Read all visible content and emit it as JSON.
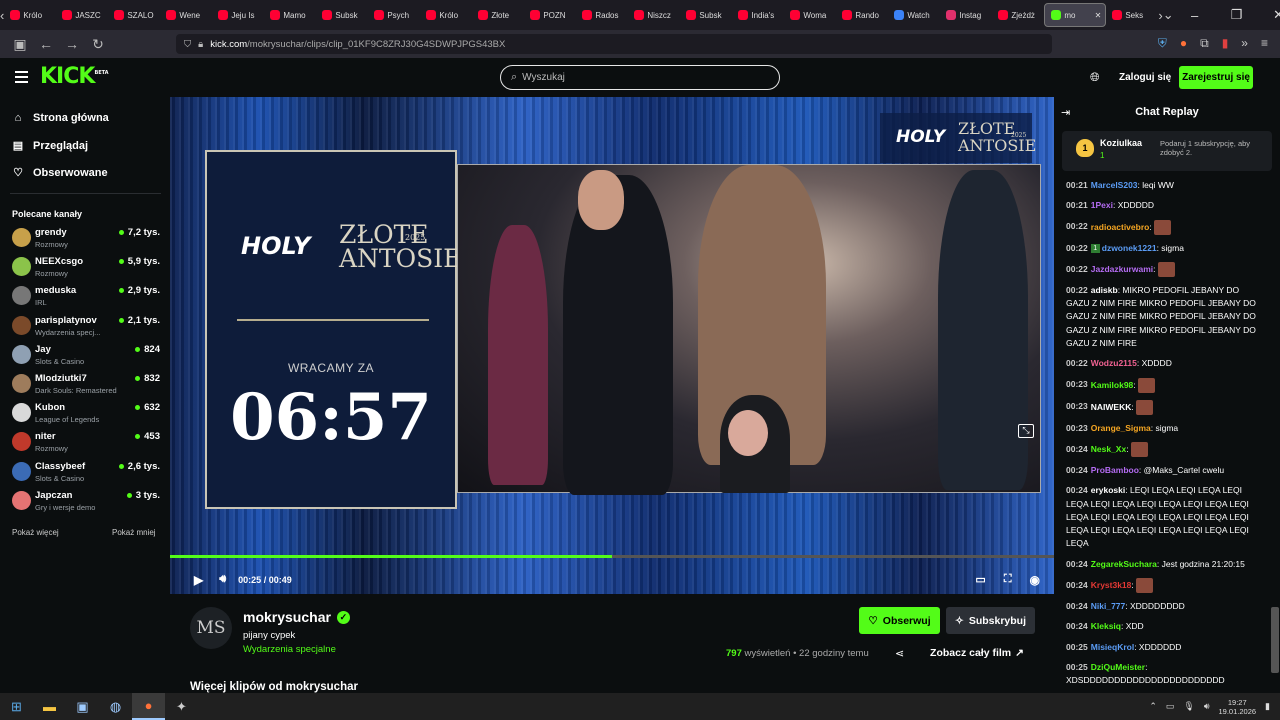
{
  "browser": {
    "tabs": [
      {
        "label": "Królo",
        "color": "#ff0033"
      },
      {
        "label": "JASZC",
        "color": "#ff0033"
      },
      {
        "label": "SZALO",
        "color": "#ff0033"
      },
      {
        "label": "Wene",
        "color": "#ff0033"
      },
      {
        "label": "Jeju Is",
        "color": "#ff0033"
      },
      {
        "label": "Mamo",
        "color": "#ff0033"
      },
      {
        "label": "Subsk",
        "color": "#ff0033"
      },
      {
        "label": "Psych",
        "color": "#ff0033"
      },
      {
        "label": "Królo",
        "color": "#ff0033"
      },
      {
        "label": "Złote",
        "color": "#ff0033"
      },
      {
        "label": "POZN",
        "color": "#ff0033"
      },
      {
        "label": "Rados",
        "color": "#ff0033"
      },
      {
        "label": "Niszcz",
        "color": "#ff0033"
      },
      {
        "label": "Subsk",
        "color": "#ff0033"
      },
      {
        "label": "India's",
        "color": "#ff0033"
      },
      {
        "label": "Woma",
        "color": "#ff0033"
      },
      {
        "label": "Rando",
        "color": "#ff0033"
      },
      {
        "label": "Watch",
        "color": "#3b82f6"
      },
      {
        "label": "Instag",
        "color": "#e1306c"
      },
      {
        "label": "Zjeżdż",
        "color": "#ff0033"
      }
    ],
    "active_tab": {
      "label": "mo",
      "color": "#53fc18"
    },
    "last_tab": {
      "label": "Seks",
      "color": "#ff0033"
    },
    "url_host": "kick.com",
    "url_path": "/mokrysuchar/clips/clip_01KF9C8ZRJ30G4SDWPJPGS43BX"
  },
  "header": {
    "logo": "KICK",
    "beta": "BETA",
    "search_placeholder": "Wyszukaj",
    "login": "Zaloguj się",
    "register": "Zarejestruj się"
  },
  "sidebar": {
    "nav": [
      {
        "label": "Strona główna",
        "icon": "home-icon"
      },
      {
        "label": "Przeglądaj",
        "icon": "browse-icon"
      },
      {
        "label": "Obserwowane",
        "icon": "heart-icon"
      }
    ],
    "recommended_title": "Polecane kanały",
    "channels": [
      {
        "name": "grendy",
        "category": "Rozmowy",
        "viewers": "7,2 tys.",
        "color": "#c7a04a"
      },
      {
        "name": "NEEXcsgo",
        "category": "Rozmowy",
        "viewers": "5,9 tys.",
        "color": "#8bc34a"
      },
      {
        "name": "meduska",
        "category": "IRL",
        "viewers": "2,9 tys.",
        "color": "#777777"
      },
      {
        "name": "parisplatynov",
        "category": "Wydarzenia specj...",
        "viewers": "2,1 tys.",
        "color": "#7b4a2a"
      },
      {
        "name": "Jay",
        "category": "Slots & Casino",
        "viewers": "824",
        "color": "#8fa0b3"
      },
      {
        "name": "Mlodziutki7",
        "category": "Dark Souls: Remastered",
        "viewers": "832",
        "color": "#9e7c5c"
      },
      {
        "name": "Kubon",
        "category": "League of Legends",
        "viewers": "632",
        "color": "#d9d9d9"
      },
      {
        "name": "niter",
        "category": "Rozmowy",
        "viewers": "453",
        "color": "#c0392b"
      },
      {
        "name": "Classybeef",
        "category": "Slots & Casino",
        "viewers": "2,6 tys.",
        "color": "#3b6bb5"
      },
      {
        "name": "Japczan",
        "category": "Gry i wersje demo",
        "viewers": "3 tys.",
        "color": "#e57373"
      }
    ],
    "show_more": "Pokaż więcej",
    "show_less": "Pokaż mniej"
  },
  "video": {
    "overlay_brand": "HOLY",
    "overlay_title_1": "ZŁOTE",
    "overlay_title_2": "ANTOSIE",
    "overlay_year": "2025",
    "countdown_label": "WRACAMY ZA",
    "countdown": "06:57",
    "time_current": "00:25",
    "time_total": "00:49",
    "progress": 0.5
  },
  "channel": {
    "avatar": "MS",
    "name": "mokrysuchar",
    "title": "pijany cypek",
    "category": "Wydarzenia specjalne",
    "follow": "Obserwuj",
    "subscribe": "Subskrybuj",
    "views": "797",
    "views_label": "wyświetleń",
    "age": "• 22 godziny temu",
    "full_film": "Zobacz cały film",
    "more_clips": "Więcej klipów od mokrysuchar"
  },
  "chat": {
    "title": "Chat Replay",
    "pinned": {
      "rank": "1",
      "name": "Koziulkaa",
      "count": "1",
      "desc": "Podaruj 1 subskrypcję, aby zdobyć 2."
    },
    "messages": [
      {
        "t": "00:21",
        "u": "MarcelS203",
        "c": "#5b9cf5",
        "m": ": leqi WW"
      },
      {
        "t": "00:21",
        "u": "1Pexi",
        "c": "#b46cf2",
        "m": ": XDDDDD"
      },
      {
        "t": "00:22",
        "u": "radioactivebro",
        "c": "#f5a623",
        "m": ":",
        "e": 1
      },
      {
        "t": "00:22",
        "u": "dzwonek1221",
        "c": "#5b9cf5",
        "m": ": sigma",
        "b": 1
      },
      {
        "t": "00:22",
        "u": "Jazdazkurwami",
        "c": "#b46cf2",
        "m": ":",
        "e": 1
      },
      {
        "t": "00:22",
        "u": "adiskb",
        "c": "#ffffff",
        "m": ": MIKRO PEDOFIL JEBANY DO GAZU Z NIM FIRE MIKRO PEDOFIL JEBANY DO GAZU Z NIM FIRE MIKRO PEDOFIL JEBANY DO GAZU Z NIM FIRE MIKRO PEDOFIL JEBANY DO GAZU Z NIM FIRE"
      },
      {
        "t": "00:22",
        "u": "Wodzu2115",
        "c": "#f06292",
        "m": ": XDDDD"
      },
      {
        "t": "00:23",
        "u": "Kamilok98",
        "c": "#53fc18",
        "m": ":",
        "e": 1
      },
      {
        "t": "00:23",
        "u": "NAIWEKK",
        "c": "#ffffff",
        "m": ":",
        "e": 1
      },
      {
        "t": "00:23",
        "u": "Orange_Sigma",
        "c": "#f5a623",
        "m": ": sigma"
      },
      {
        "t": "00:24",
        "u": "Nesk_Xx",
        "c": "#53fc18",
        "m": ":",
        "e": 1
      },
      {
        "t": "00:24",
        "u": "ProBamboo",
        "c": "#b46cf2",
        "m": ": @Maks_Cartel cwelu"
      },
      {
        "t": "00:24",
        "u": "erykoski",
        "c": "#ffffff",
        "m": ": LEQI LEQA LEQI LEQA LEQI LEQA LEQI LEQA LEQI LEQA LEQI LEQA LEQI LEQA LEQI LEQA LEQI LEQA LEQI LEQA LEQI LEQA LEQI LEQA LEQI LEQA LEQI LEQA LEQI LEQA"
      },
      {
        "t": "00:24",
        "u": "ZegarekSuchara",
        "c": "#53fc18",
        "m": ": Jest godzina 21:20:15"
      },
      {
        "t": "00:24",
        "u": "Kryst3k18",
        "c": "#e53935",
        "m": ":",
        "e": 1
      },
      {
        "t": "00:24",
        "u": "Niki_777",
        "c": "#5b9cf5",
        "m": ": XDDDDDDDD"
      },
      {
        "t": "00:24",
        "u": "Kleksiq",
        "c": "#53fc18",
        "m": ": XDD"
      },
      {
        "t": "00:25",
        "u": "MisieqKrol",
        "c": "#5b9cf5",
        "m": ": XDDDDDD"
      },
      {
        "t": "00:25",
        "u": "DziQuMeister",
        "c": "#53fc18",
        "m": ": XDSDDDDDDDDDDDDDDDDDDDDDDD"
      }
    ]
  },
  "taskbar": {
    "time": "19:27",
    "date": "19.01.2026"
  }
}
